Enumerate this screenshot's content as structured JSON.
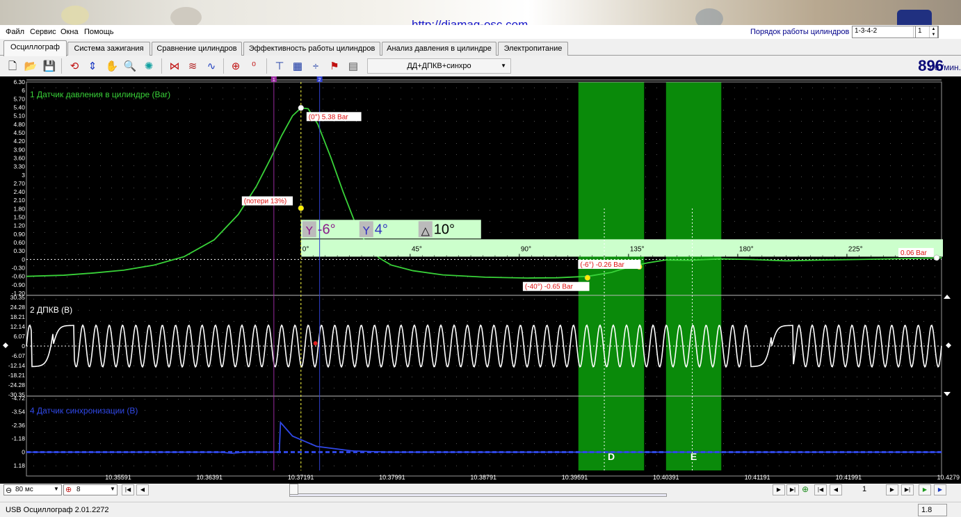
{
  "website_url": "http://diamag-osc.com",
  "menu": [
    "Файл",
    "Сервис",
    "Окна",
    "Помощь"
  ],
  "cylinder_order": {
    "label": "Порядок работы цилиндров",
    "value": "1-3-4-2",
    "cylinder": "1"
  },
  "tabs": [
    "Осциллограф",
    "Система зажигания",
    "Сравнение цилиндров",
    "Эффективность работы цилиндров",
    "Анализ давления в цилиндре",
    "Электропитание"
  ],
  "active_tab": 0,
  "toolbar": {
    "icons": [
      "new-file-icon",
      "open-folder-icon",
      "save-icon",
      "loop-icon",
      "scale-icon",
      "hand-pan-icon",
      "zoom-icon",
      "fan-icon",
      "waveform-filter-icon",
      "waves-icon",
      "waves-spectrum-icon",
      "auto-icon",
      "zero-icon",
      "cursor-filter-icon",
      "table-icon",
      "split-icon",
      "marker-flag-icon",
      "report-icon"
    ],
    "mode_value": "ДД+ДПКВ+синхро",
    "rpm": "896",
    "rpm_unit": "об./мин."
  },
  "chart_data": [
    {
      "type": "line",
      "title": "1 Датчик давления в цилиндре (Bar)",
      "color": "#39d339",
      "ylim": [
        -1.2,
        6.3
      ],
      "y_ticks": [
        "6.30",
        "6",
        "5.70",
        "5.40",
        "5.10",
        "4.80",
        "4.50",
        "4.20",
        "3.90",
        "3.60",
        "3.30",
        "3",
        "2.70",
        "2.40",
        "2.10",
        "1.80",
        "1.50",
        "1.20",
        "0.90",
        "0.60",
        "0.30",
        "0",
        "-0.30",
        "-0.60",
        "-0.90",
        "-1.20"
      ],
      "series_points": [
        [
          10.3519,
          -0.6
        ],
        [
          10.355,
          -0.56
        ],
        [
          10.3575,
          -0.48
        ],
        [
          10.36,
          -0.38
        ],
        [
          10.3625,
          -0.2
        ],
        [
          10.365,
          0.1
        ],
        [
          10.3675,
          0.7
        ],
        [
          10.3695,
          1.6
        ],
        [
          10.371,
          2.6
        ],
        [
          10.3722,
          3.6
        ],
        [
          10.3731,
          4.4
        ],
        [
          10.374,
          5.1
        ],
        [
          10.3747,
          5.38
        ],
        [
          10.3753,
          5.35
        ],
        [
          10.3761,
          4.8
        ],
        [
          10.3772,
          3.6
        ],
        [
          10.3782,
          2.4
        ],
        [
          10.3792,
          1.3
        ],
        [
          10.3802,
          0.5
        ],
        [
          10.3812,
          0.05
        ],
        [
          10.3822,
          -0.2
        ],
        [
          10.384,
          -0.4
        ],
        [
          10.3865,
          -0.55
        ],
        [
          10.39,
          -0.63
        ],
        [
          10.3935,
          -0.66
        ],
        [
          10.396,
          -0.65
        ],
        [
          10.3985,
          -0.6
        ],
        [
          10.4005,
          -0.46
        ],
        [
          10.402,
          -0.26
        ],
        [
          10.4035,
          -0.12
        ],
        [
          10.405,
          -0.02
        ],
        [
          10.407,
          -0.03
        ],
        [
          10.4095,
          0.02
        ],
        [
          10.412,
          0.0
        ],
        [
          10.415,
          -0.05
        ],
        [
          10.418,
          -0.02
        ],
        [
          10.421,
          0.0
        ],
        [
          10.425,
          0.03
        ],
        [
          10.4279,
          0.06
        ]
      ],
      "annotations": [
        {
          "text": "(0°) 5.38 Bar",
          "x": 10.3747,
          "y": 5.38
        },
        {
          "text": "(потери 13%)",
          "x": 10.3747,
          "y": 1.82
        },
        {
          "text": "(-6°) -0.26 Bar",
          "x": 10.4028,
          "y": -0.26
        },
        {
          "text": "(-40°) -0.65 Bar",
          "x": 10.3985,
          "y": -0.65
        },
        {
          "text": "0.06 Bar",
          "x": 10.4279,
          "y": 0.06
        }
      ],
      "angle_cursors": [
        {
          "label": "-6°",
          "color": "#8a1a8a"
        },
        {
          "label": "4°",
          "color": "#3030c0"
        },
        {
          "label": "10°",
          "color": "#000000"
        }
      ],
      "angle_ticks": [
        "0°",
        "45°",
        "90°",
        "135°",
        "180°",
        "225°"
      ]
    },
    {
      "type": "line",
      "title": "2 ДПКВ (В)",
      "color": "#ffffff",
      "ylim": [
        -30.35,
        30.35
      ],
      "y_ticks": [
        "30.35",
        "24.28",
        "18.21",
        "12.14",
        "6.07",
        "0",
        "-6.07",
        "-12.14",
        "-18.21",
        "-24.28",
        "-30.35"
      ],
      "amplitude": 13,
      "cycles": 69,
      "missing_tooth_at": [
        10.3541,
        10.4138
      ]
    },
    {
      "type": "line",
      "title": "4 Датчик синхронизации (В)",
      "color": "#3048e8",
      "ylim": [
        -4.72,
        1.18
      ],
      "y_ticks": [
        "-4.72",
        "-3.54",
        "-2.36",
        "-1.18",
        "0",
        "1.18"
      ],
      "series_points": [
        [
          10.3519,
          0.0
        ],
        [
          10.368,
          0.0
        ],
        [
          10.369,
          0.1
        ],
        [
          10.37,
          0.0
        ],
        [
          10.3729,
          0.0
        ],
        [
          10.373,
          -2.6
        ],
        [
          10.374,
          -1.4
        ],
        [
          10.376,
          -0.5
        ],
        [
          10.379,
          -0.1
        ],
        [
          10.382,
          0.0
        ],
        [
          10.4279,
          0.0
        ]
      ]
    }
  ],
  "x_ticks": [
    "10.35591",
    "10.36391",
    "10.37191",
    "10.37991",
    "10.38791",
    "10.39591",
    "10.40391",
    "10.41191",
    "10.41991",
    "10.4279"
  ],
  "zones": [
    {
      "label": "D",
      "from": 10.39774,
      "to": 10.4032
    },
    {
      "label": "E",
      "from": 10.40502,
      "to": 10.40961
    }
  ],
  "bottom": {
    "timebase": "80 мс",
    "channels": "8",
    "page": "1"
  },
  "status": {
    "text": "USB Осциллограф  2.01.2272",
    "right": "1.8"
  }
}
